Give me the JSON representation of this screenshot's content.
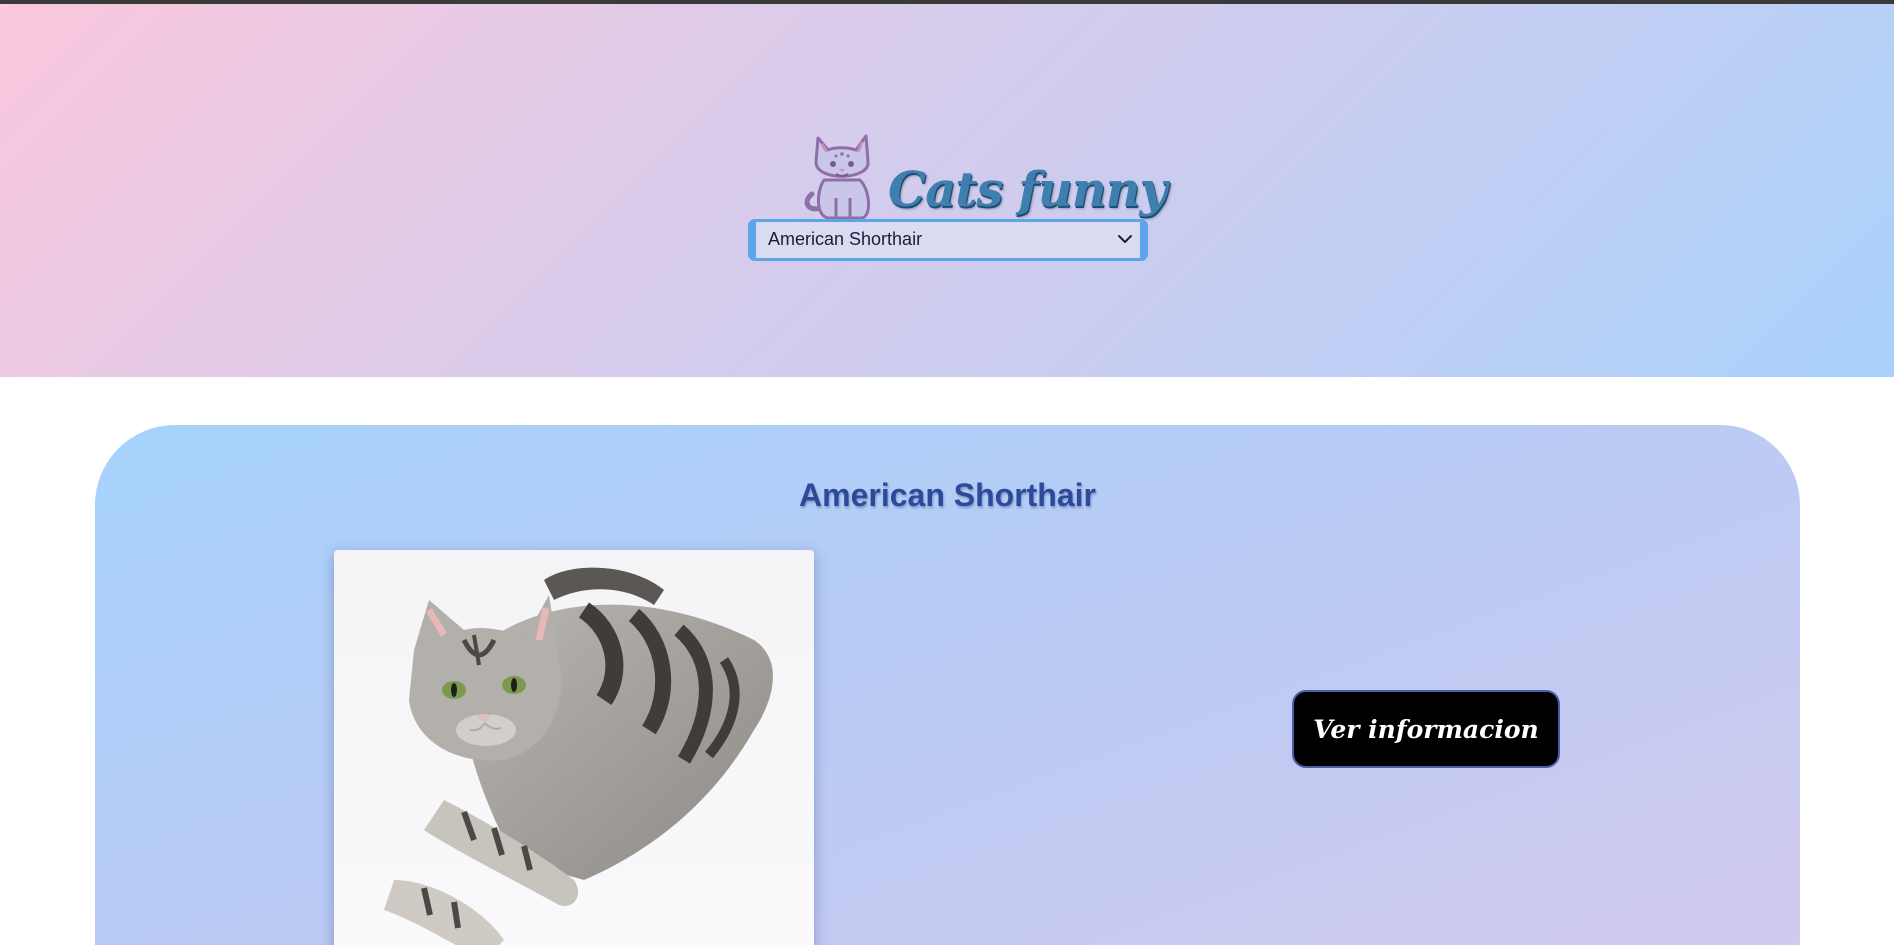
{
  "header": {
    "brand_title": "Cats funny",
    "logo_icon": "cat-logo-icon"
  },
  "breed_select": {
    "selected": "American Shorthair",
    "icon": "chevron-down-icon"
  },
  "breed_card": {
    "name": "American Shorthair",
    "image_alt": "cat-photo",
    "button_label": "Ver informacion"
  },
  "colors": {
    "header_gradient_start": "#fbc8dd",
    "header_gradient_end": "#a9d2fb",
    "card_gradient_start": "#a6d3fc",
    "card_gradient_end": "#d1c9ee",
    "title_color": "#2d4a9a",
    "button_bg": "#000000",
    "select_border": "#5ea4ea"
  }
}
